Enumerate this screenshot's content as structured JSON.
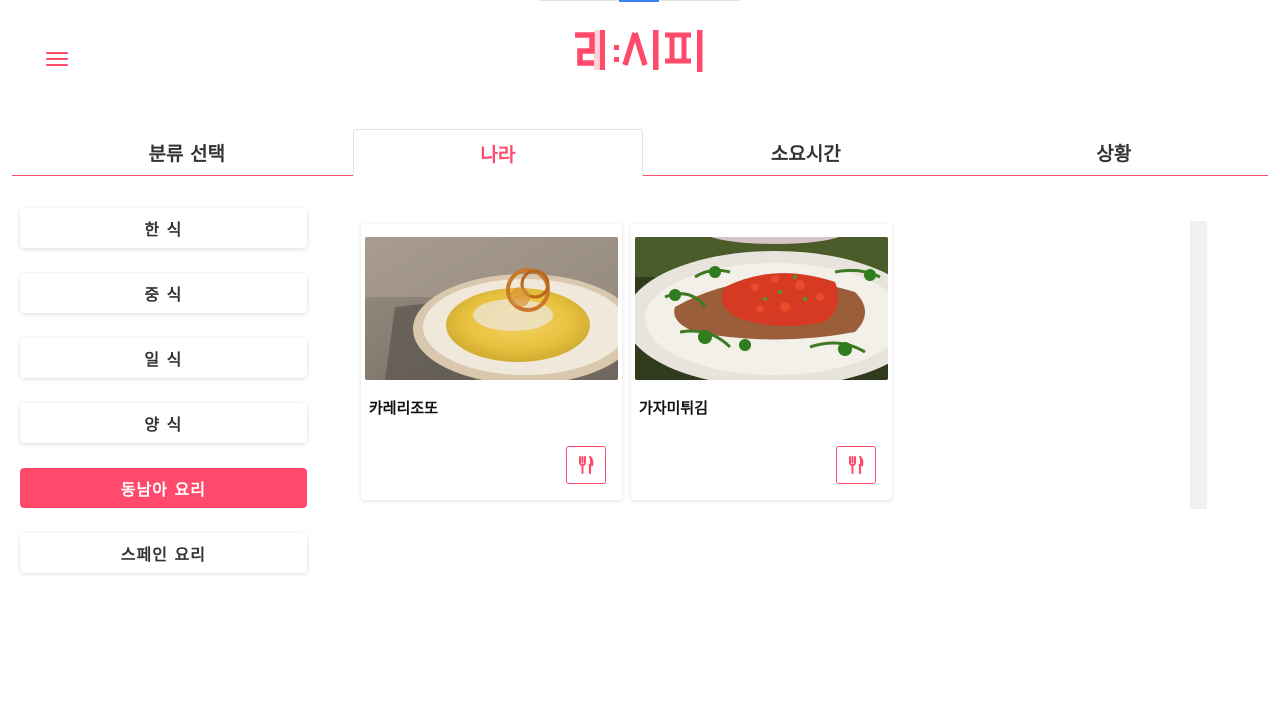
{
  "header": {
    "logo_text": "레:시피",
    "menu_icon": "hamburger-icon"
  },
  "tabs": [
    {
      "label": "분류 선택",
      "active": false
    },
    {
      "label": "나라",
      "active": true
    },
    {
      "label": "소요시간",
      "active": false
    },
    {
      "label": "상황",
      "active": false
    }
  ],
  "sidebar": {
    "items": [
      {
        "label": "한 식",
        "active": false
      },
      {
        "label": "중 식",
        "active": false
      },
      {
        "label": "일 식",
        "active": false
      },
      {
        "label": "양 식",
        "active": false
      },
      {
        "label": "동남아 요리",
        "active": true
      },
      {
        "label": "스페인 요리",
        "active": false
      }
    ]
  },
  "recipes": [
    {
      "title": "카레리조또",
      "button_icon": "fork-knife-icon"
    },
    {
      "title": "가자미튀김",
      "button_icon": "fork-knife-icon"
    }
  ],
  "colors": {
    "accent": "#ff4a6b",
    "tab_border": "#e2e2e2",
    "text": "#333333"
  }
}
